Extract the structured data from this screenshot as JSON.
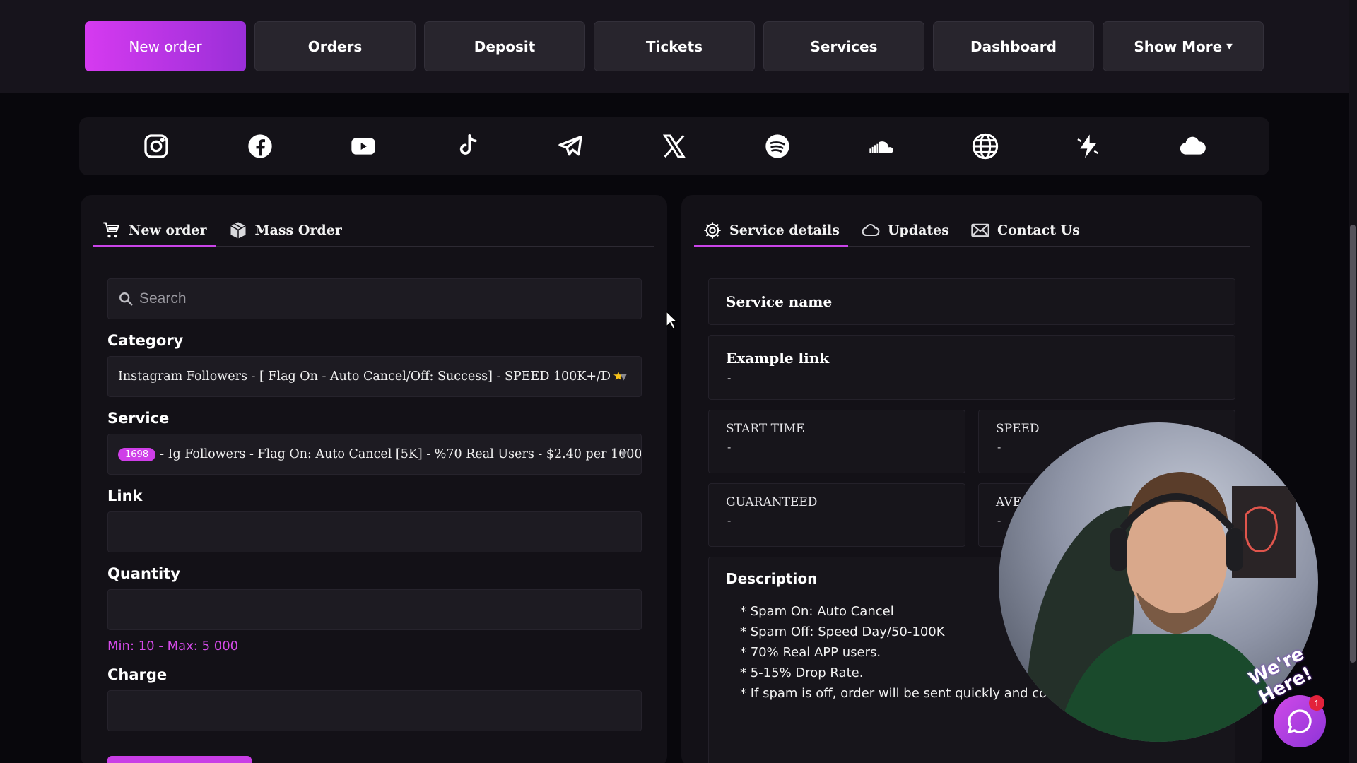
{
  "nav": {
    "items": [
      {
        "label": "New order",
        "active": true
      },
      {
        "label": "Orders"
      },
      {
        "label": "Deposit"
      },
      {
        "label": "Tickets"
      },
      {
        "label": "Services"
      },
      {
        "label": "Dashboard"
      },
      {
        "label": "Show More"
      }
    ]
  },
  "social": [
    "instagram-icon",
    "facebook-icon",
    "youtube-icon",
    "tiktok-icon",
    "telegram-icon",
    "x-icon",
    "spotify-icon",
    "soundcloud-icon",
    "globe-icon",
    "bolt-icon",
    "cloud-icon"
  ],
  "order_panel": {
    "tabs": [
      {
        "label": "New order"
      },
      {
        "label": "Mass Order"
      }
    ],
    "search": {
      "placeholder": "Search"
    },
    "category_label": "Category",
    "category_value": "Instagram Followers - [ Flag On - Auto Cancel/Off: Success] - SPEED 100K+/D",
    "service_label": "Service",
    "service_id": "1698",
    "service_value": "- Ig Followers - Flag On: Auto Cancel [5K] - %70 Real Users - $2.40 per 1000",
    "link_label": "Link",
    "quantity_label": "Quantity",
    "minmax": "Min: 10 - Max: 5 000",
    "charge_label": "Charge"
  },
  "details_panel": {
    "tabs": [
      {
        "label": "Service details"
      },
      {
        "label": "Updates"
      },
      {
        "label": "Contact Us"
      }
    ],
    "service_name": "Service name",
    "example_link": "Example link",
    "example_link_value": "-",
    "start_time": "START TIME",
    "start_time_value": "-",
    "speed": "SPEED",
    "speed_value": "-",
    "guaranteed": "GUARANTEED",
    "guaranteed_value": "-",
    "average": "AVE",
    "average_value": "-",
    "description_title": "Description",
    "description": [
      "* Spam On: Auto Cancel",
      "* Spam Off: Speed Day/50-100K",
      "* 70% Real APP users.",
      "* 5-15% Drop Rate.",
      "* If spam is off, order will be sent quickly and co"
    ]
  },
  "chat": {
    "sticker": "We're Here!",
    "count": "1"
  },
  "colors": {
    "accent": "#cf3ee8",
    "background": "#08070c",
    "panel": "#131117"
  }
}
